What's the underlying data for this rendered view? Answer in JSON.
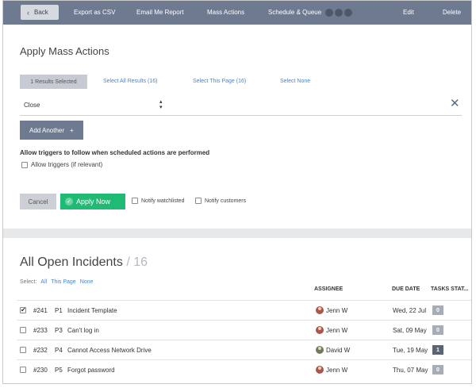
{
  "toolbar": {
    "back_label": "Back",
    "export_csv": "Export as CSV",
    "email_report": "Email Me Report",
    "mass_actions": "Mass Actions",
    "schedule_queue": "Schedule & Queue",
    "edit": "Edit",
    "delete": "Delete"
  },
  "mass_actions": {
    "title": "Apply Mass Actions",
    "results_selected": "1 Results Selected",
    "select_all_results": "Select All Results (16)",
    "select_this_page": "Select This Page (16)",
    "select_none": "Select None",
    "action_value": "Close",
    "add_another": "Add Another",
    "trigger_heading": "Allow triggers to follow when scheduled actions are performed",
    "allow_triggers_label": "Allow triggers (if relevant)",
    "allow_triggers_checked": false,
    "cancel": "Cancel",
    "apply_now": "Apply Now",
    "notify_watchlisted": "Notify watchlisted",
    "notify_customers": "Notify customers"
  },
  "incidents": {
    "title": "All Open Incidents",
    "count": "/ 16",
    "select_label": "Select:",
    "select_all": "All",
    "select_page": "This Page",
    "select_none": "None",
    "columns": {
      "assignee": "ASSIGNEE",
      "due_date": "DUE DATE",
      "tasks_status": "TASKS STAT..."
    },
    "rows": [
      {
        "id": "#241",
        "priority": "P1",
        "subject": "Incident Template",
        "assignee": "Jenn W",
        "due": "Wed, 22 Jul",
        "tasks": "0",
        "checked": true
      },
      {
        "id": "#233",
        "priority": "P3",
        "subject": "Can't log in",
        "assignee": "Jenn W",
        "due": "Sat, 09 May",
        "tasks": "0",
        "checked": false
      },
      {
        "id": "#232",
        "priority": "P4",
        "subject": "Cannot Access Network Drive",
        "assignee": "David W",
        "due": "Tue, 19 May",
        "tasks": "1",
        "checked": false
      },
      {
        "id": "#230",
        "priority": "P5",
        "subject": "Forgot password",
        "assignee": "Jenn W",
        "due": "Thu, 07 May",
        "tasks": "0",
        "checked": false
      }
    ]
  },
  "colors": {
    "toolbar_bg": "#6e7a90",
    "apply_green": "#1fba74",
    "link_blue": "#4a86c8"
  }
}
